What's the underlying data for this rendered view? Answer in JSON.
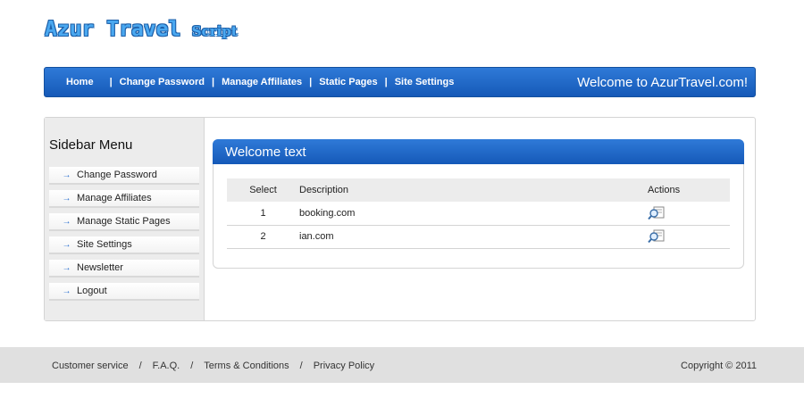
{
  "logo": {
    "main": "Azur Travel",
    "sub": "Script"
  },
  "nav": {
    "items": [
      "Home",
      "Change Password",
      "Manage Affiliates",
      "Static Pages",
      "Site Settings"
    ],
    "separator": "|",
    "welcome": "Welcome to AzurTravel.com!"
  },
  "sidebar": {
    "title": "Sidebar Menu",
    "items": [
      "Change Password",
      "Manage Affiliates",
      "Manage Static Pages",
      "Site Settings",
      "Newsletter",
      "Logout"
    ]
  },
  "panel": {
    "title": "Welcome text",
    "columns": [
      "Select",
      "Description",
      "Actions"
    ],
    "rows": [
      {
        "select": "1",
        "description": "booking.com",
        "action_icon": "view-magnifier-icon"
      },
      {
        "select": "2",
        "description": "ian.com",
        "action_icon": "view-magnifier-icon"
      }
    ]
  },
  "footer": {
    "links": [
      "Customer service",
      "F.A.Q.",
      "Terms & Conditions",
      "Privacy Policy"
    ],
    "separator": "/",
    "copyright": "Copyright © 2011"
  },
  "colors": {
    "accent": "#1f66c8",
    "logo": "#4aa8f0",
    "footer_bg": "#e0e0e0"
  }
}
